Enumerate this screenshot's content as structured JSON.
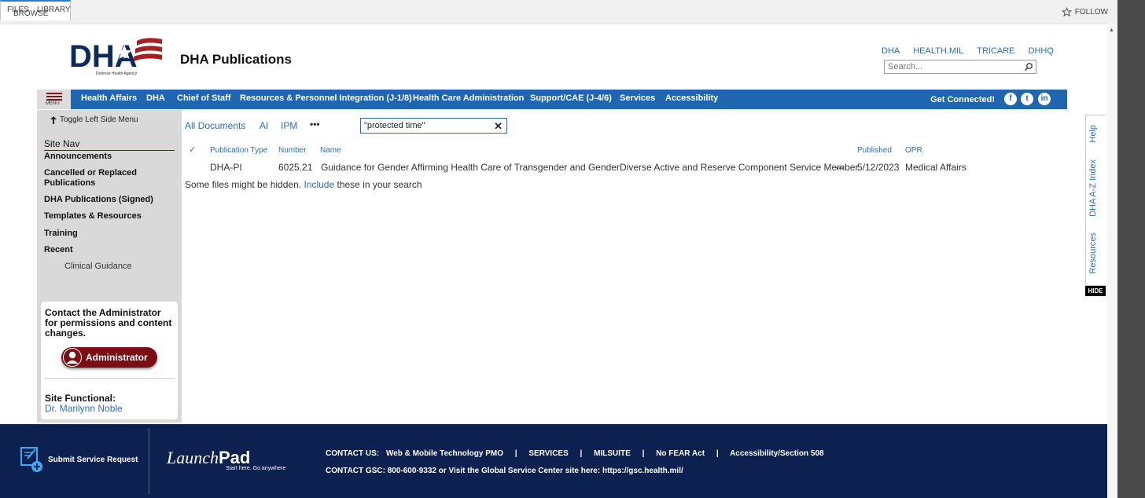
{
  "ribbon": {
    "tabs": [
      "BROWSE",
      "FILES",
      "LIBRARY"
    ],
    "follow_label": "FOLLOW"
  },
  "header": {
    "logo_text": "DHA",
    "logo_subtext": "Defense Health Agency",
    "site_title": "DHA Publications",
    "ext_links": [
      "DHA",
      "HEALTH.MIL",
      "TRICARE",
      "DHHQ"
    ],
    "search_placeholder": "Search..."
  },
  "navbar": {
    "menu_label": "MENU",
    "items": [
      "Health Affairs",
      "DHA",
      "Chief of Staff",
      "Resources & Personnel Integration (J-1/8)",
      "Health Care Administration",
      "Support/CAE (J-4/6)",
      "Services",
      "Accessibility"
    ],
    "get_connected": "Get Connected!"
  },
  "left_panel": {
    "toggle_label": "Toggle Left Side Menu",
    "site_nav_title": "Site Nav",
    "items": [
      "Announcements",
      "Cancelled or Replaced Publications",
      "DHA Publications (Signed)",
      "Templates & Resources",
      "Training",
      "Recent"
    ],
    "recent_sub": "Clinical Guidance",
    "contact_text": "Contact the Administrator for permissions and content changes.",
    "admin_button": "Administrator",
    "site_functional_label": "Site Functional:",
    "site_functional_name": "Dr. Marilynn Noble"
  },
  "main": {
    "views": [
      "All Documents",
      "AI",
      "IPM"
    ],
    "more_views": "•••",
    "search_value": "\"protected time\"",
    "columns": {
      "type": "Publication Type",
      "number": "Number",
      "name": "Name",
      "published": "Published",
      "opr": "OPR"
    },
    "rows": [
      {
        "type": "DHA-PI",
        "number": "6025.21",
        "name": "Guidance for Gender Affirming Health Care of Transgender and GenderDiverse Active and Reserve Component Service Member",
        "published": "5/12/2023",
        "opr": "Medical Affairs"
      }
    ],
    "row_menu": "...",
    "hidden_note_prefix": "Some files might be hidden.",
    "hidden_note_link": "Include",
    "hidden_note_suffix": "these in your search"
  },
  "side_tabs": [
    "Help",
    "DHA A-Z Index",
    "Resources"
  ],
  "hide_label": "HIDE",
  "footer": {
    "submit_request": "Submit Service Request",
    "launchpad_a": "Launch",
    "launchpad_b": "Pad",
    "launchpad_tag": "Start here. Go anywhere",
    "contact_label": "CONTACT US:",
    "contact_items": [
      "Web & Mobile Technology PMO",
      "SERVICES",
      "MILSUITE",
      "No FEAR Act",
      "Accessibility/Section 508"
    ],
    "gsc_text": "CONTACT GSC: 800-600-9332 or Visit the Global Service Center site here: https://gsc.health.mil/"
  },
  "colors": {
    "nav_blue": "#1f66b1",
    "footer_navy": "#0c2150",
    "admin_red": "#7a0e12",
    "link_blue": "#2a6ebb"
  }
}
